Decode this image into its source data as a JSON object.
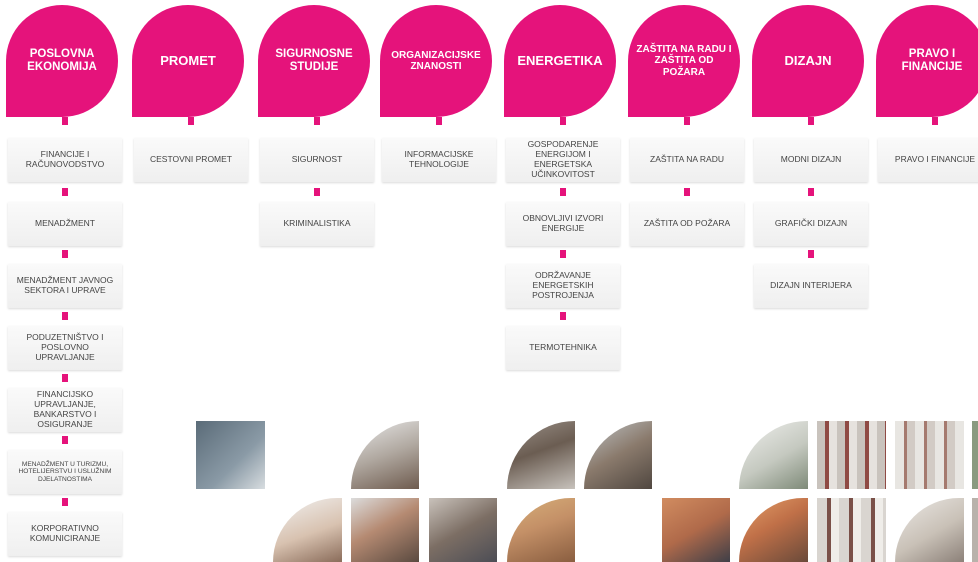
{
  "programs": [
    {
      "id": "poslovna-ekonomija",
      "title": "POSLOVNA EKONOMIJA",
      "courses": [
        "FINANCIJE I RAČUNOVODSTVO",
        "MENADŽMENT",
        "MENADŽMENT JAVNOG SEKTORA I UPRAVE",
        "PODUZETNIŠTVO I POSLOVNO UPRAVLJANJE",
        "FINANCIJSKO UPRAVLJANJE, BANKARSTVO I OSIGURANJE",
        "MENADŽMENT U TURIZMU, HOTELIJERSTVU I USLUŽNIM DJELATNOSTIMA",
        "KORPORATIVNO KOMUNICIRANJE"
      ]
    },
    {
      "id": "promet",
      "title": "PROMET",
      "courses": [
        "CESTOVNI PROMET"
      ]
    },
    {
      "id": "sigurnosne-studije",
      "title": "SIGURNOSNE STUDIJE",
      "courses": [
        "SIGURNOST",
        "KRIMINALISTIKA"
      ]
    },
    {
      "id": "organizacijske-znanosti",
      "title": "ORGANIZACIJSKE ZNANOSTI",
      "courses": [
        "INFORMACIJSKE TEHNOLOGIJE"
      ]
    },
    {
      "id": "energetika",
      "title": "ENERGETIKA",
      "courses": [
        "GOSPODARENJE ENERGIJOM I ENERGETSKA UČINKOVITOST",
        "OBNOVLJIVI IZVORI ENERGIJE",
        "ODRŽAVANJE ENERGETSKIH POSTROJENJA",
        "TERMOTEHNIKA"
      ]
    },
    {
      "id": "zastita",
      "title": "ZAŠTITA NA RADU I ZAŠTITA OD POŽARA",
      "courses": [
        "ZAŠTITA NA RADU",
        "ZAŠTITA OD POŽARA"
      ]
    },
    {
      "id": "dizajn",
      "title": "DIZAJN",
      "courses": [
        "MODNI DIZAJN",
        "GRAFIČKI DIZAJN",
        "DIZAJN INTERIJERA"
      ]
    },
    {
      "id": "pravo",
      "title": "PRAVO I FINANCIJE",
      "courses": [
        "PRAVO I FINANCIJE"
      ]
    }
  ],
  "colors": {
    "accent": "#e5137b",
    "card_bg": "#f3f3f3",
    "text": "#444444"
  }
}
